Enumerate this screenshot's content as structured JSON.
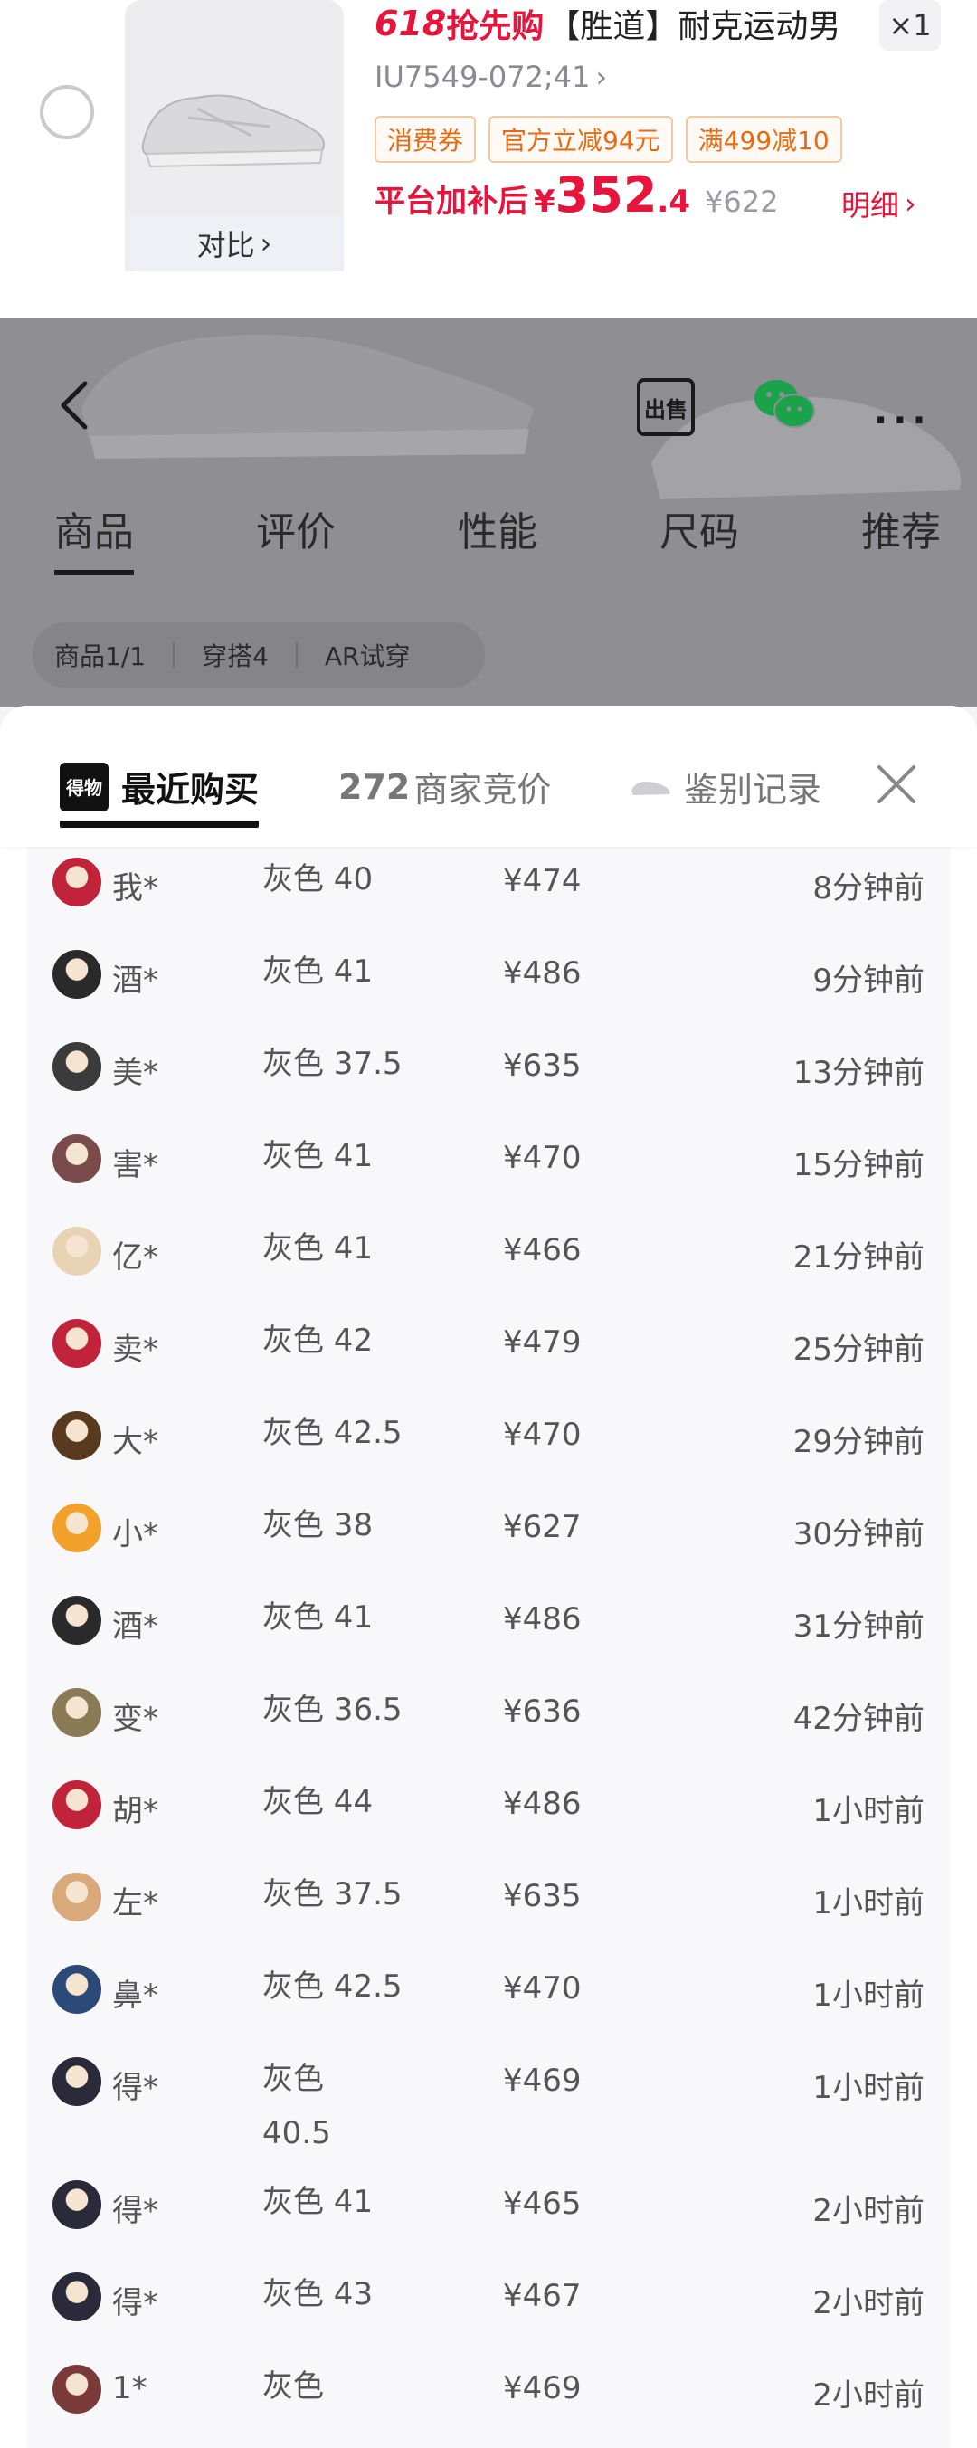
{
  "cart": {
    "promo_prefix": "618",
    "promo_suffix": "抢先购",
    "title": "【胜道】耐克运动男",
    "quantity": "×1",
    "sku": "IU7549-072;41",
    "compare_label": "对比",
    "tags": [
      "消费券",
      "官方立减94元",
      "满499减10"
    ],
    "price_label": "平台加补后",
    "currency": "¥",
    "price_int": "352",
    "price_dec": ".4",
    "original_price": "¥622",
    "detail_label": "明细",
    "accent_color": "#e8143c"
  },
  "product_page": {
    "sell_label": "出售",
    "more_label": "···",
    "tabs": [
      "商品",
      "评价",
      "性能",
      "尺码",
      "推荐"
    ],
    "chips": [
      "商品1/1",
      "穿搭4",
      "AR试穿"
    ]
  },
  "sheet": {
    "logo_text": "得物",
    "tab_recent": "最近购买",
    "tab_bids_count": "272",
    "tab_bids": "商家竞价",
    "tab_auth": "鉴别记录"
  },
  "purchases": [
    {
      "buyer": "我*",
      "spec": "灰色 40",
      "price": "¥474",
      "time": "8分钟前",
      "avatar_color": "#c0233a"
    },
    {
      "buyer": "酒*",
      "spec": "灰色 41",
      "price": "¥486",
      "time": "9分钟前",
      "avatar_color": "#2a2a2a"
    },
    {
      "buyer": "美*",
      "spec": "灰色 37.5",
      "price": "¥635",
      "time": "13分钟前",
      "avatar_color": "#3b3b3b"
    },
    {
      "buyer": "害*",
      "spec": "灰色 41",
      "price": "¥470",
      "time": "15分钟前",
      "avatar_color": "#7a4b4b"
    },
    {
      "buyer": "亿*",
      "spec": "灰色 41",
      "price": "¥466",
      "time": "21分钟前",
      "avatar_color": "#e9d3b5"
    },
    {
      "buyer": "卖*",
      "spec": "灰色 42",
      "price": "¥479",
      "time": "25分钟前",
      "avatar_color": "#c0233a"
    },
    {
      "buyer": "大*",
      "spec": "灰色 42.5",
      "price": "¥470",
      "time": "29分钟前",
      "avatar_color": "#5a3a1e"
    },
    {
      "buyer": "小*",
      "spec": "灰色 38",
      "price": "¥627",
      "time": "30分钟前",
      "avatar_color": "#f2a12b"
    },
    {
      "buyer": "酒*",
      "spec": "灰色 41",
      "price": "¥486",
      "time": "31分钟前",
      "avatar_color": "#2a2a2a"
    },
    {
      "buyer": "变*",
      "spec": "灰色 36.5",
      "price": "¥636",
      "time": "42分钟前",
      "avatar_color": "#8a7a55"
    },
    {
      "buyer": "胡*",
      "spec": "灰色 44",
      "price": "¥486",
      "time": "1小时前",
      "avatar_color": "#c0233a"
    },
    {
      "buyer": "左*",
      "spec": "灰色 37.5",
      "price": "¥635",
      "time": "1小时前",
      "avatar_color": "#d9a97a"
    },
    {
      "buyer": "鼻*",
      "spec": "灰色 42.5",
      "price": "¥470",
      "time": "1小时前",
      "avatar_color": "#2b4a7a"
    },
    {
      "buyer": "得*",
      "spec": "灰色 40.5",
      "price": "¥469",
      "time": "1小时前",
      "avatar_color": "#2a2a3a"
    },
    {
      "buyer": "得*",
      "spec": "灰色 41",
      "price": "¥465",
      "time": "2小时前",
      "avatar_color": "#2a2a3a"
    },
    {
      "buyer": "得*",
      "spec": "灰色 43",
      "price": "¥467",
      "time": "2小时前",
      "avatar_color": "#2a2a3a"
    },
    {
      "buyer": "1*",
      "spec": "灰色",
      "price": "¥469",
      "time": "2小时前",
      "avatar_color": "#7a3a3a"
    }
  ]
}
